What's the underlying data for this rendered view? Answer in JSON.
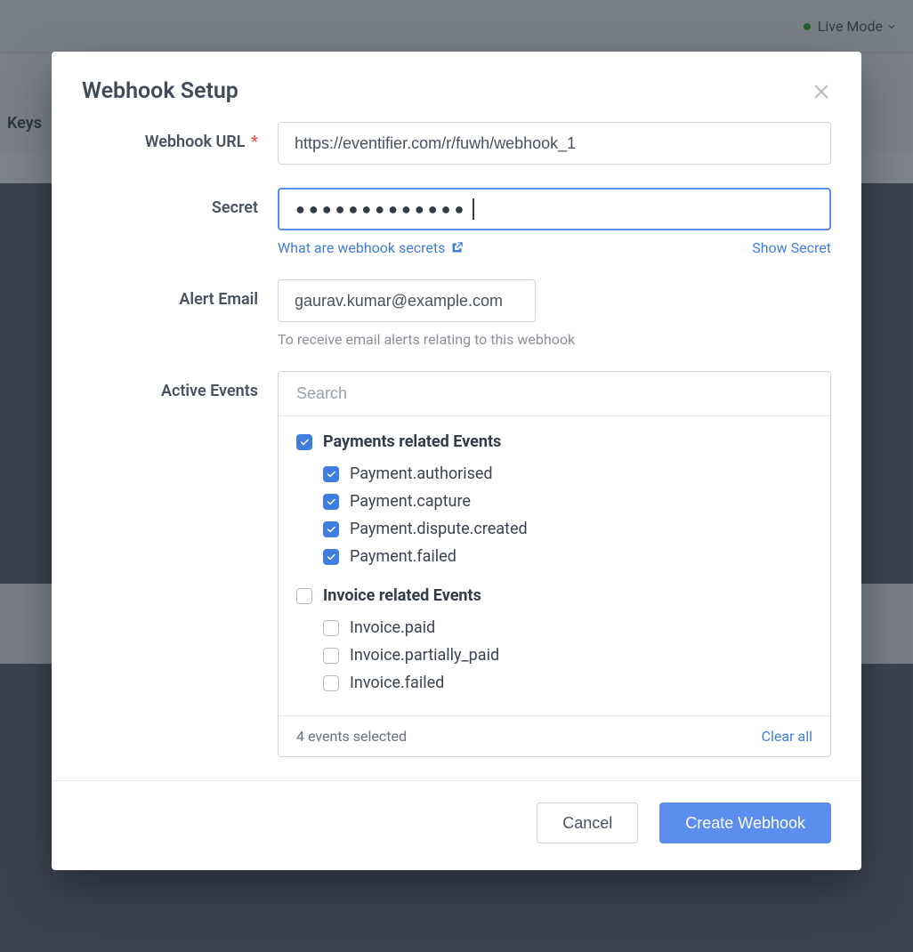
{
  "topbar": {
    "mode_label": "Live Mode"
  },
  "background": {
    "keys_label": "Keys"
  },
  "modal": {
    "title": "Webhook Setup",
    "labels": {
      "webhook_url": "Webhook URL",
      "secret": "Secret",
      "alert_email": "Alert Email",
      "active_events": "Active Events"
    },
    "webhook_url_value": "https://eventifier.com/r/fuwh/webhook_1",
    "secret_value": "●●●●●●●●●●●●●",
    "secret_help_link": "What are webhook secrets",
    "show_secret_label": "Show Secret",
    "alert_email_value": "gaurav.kumar@example.com",
    "alert_email_help": "To receive email alerts relating to this webhook",
    "events": {
      "search_placeholder": "Search",
      "groups": [
        {
          "title": "Payments related Events",
          "checked": true,
          "items": [
            {
              "label": "Payment.authorised",
              "checked": true
            },
            {
              "label": "Payment.capture",
              "checked": true
            },
            {
              "label": "Payment.dispute.created",
              "checked": true
            },
            {
              "label": "Payment.failed",
              "checked": true
            }
          ]
        },
        {
          "title": "Invoice related Events",
          "checked": false,
          "items": [
            {
              "label": "Invoice.paid",
              "checked": false
            },
            {
              "label": "Invoice.partially_paid",
              "checked": false
            },
            {
              "label": "Invoice.failed",
              "checked": false
            }
          ]
        }
      ],
      "selected_text": "4 events selected",
      "clear_all": "Clear all"
    },
    "buttons": {
      "cancel": "Cancel",
      "create": "Create Webhook"
    }
  }
}
